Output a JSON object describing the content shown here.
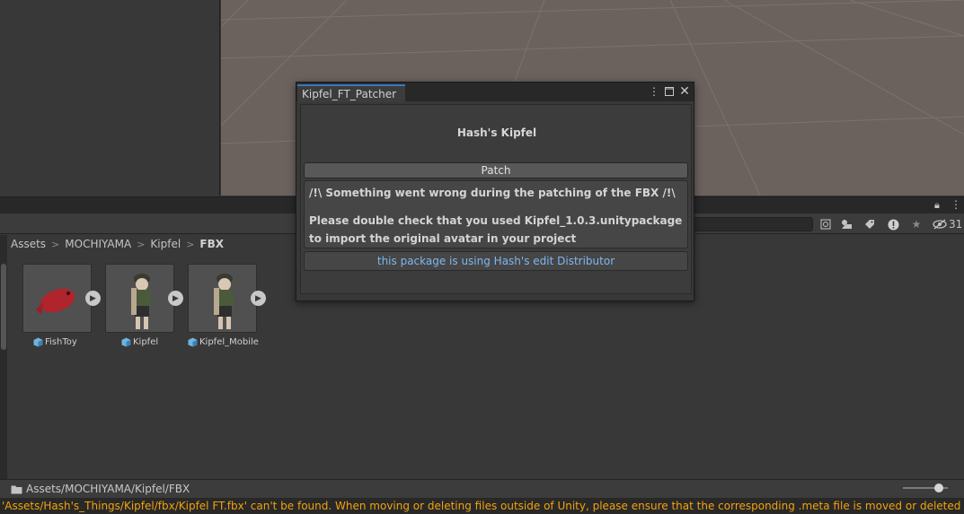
{
  "project": {
    "breadcrumb": [
      "Assets",
      "MOCHIYAMA",
      "Kipfel",
      "FBX"
    ],
    "breadcrumb_separator": ">",
    "hidden_count": "31",
    "assets": [
      {
        "name": "FishToy"
      },
      {
        "name": "Kipfel"
      },
      {
        "name": "Kipfel_Mobile"
      }
    ],
    "path": "Assets/MOCHIYAMA/Kipfel/FBX"
  },
  "window": {
    "tab_title": "Kipfel_FT_Patcher",
    "heading": "Hash's Kipfel",
    "patch_button": "Patch",
    "error_line": "/!\\ Something went wrong during the patching of the FBX /!\\",
    "hint_line1": "Please double check that you used Kipfel_1.0.3.unitypackage",
    "hint_line2": "to import the original avatar in your project",
    "link_text": "this package is using Hash's edit Distributor"
  },
  "status": {
    "message": "'Assets/Hash's_Things/Kipfel/fbx/Kipfel FT.fbx' can't be found. When moving or deleting files outside of Unity, please ensure that the corresponding .meta file is moved or deleted along with it."
  },
  "colors": {
    "status_warning": "#f2a20c",
    "link": "#7fb6f0",
    "tab_accent": "#3a79bb"
  },
  "icons": [
    "lock-icon",
    "kebab-menu-icon",
    "search-by-type-icon",
    "search-by-label-icon",
    "tag-icon",
    "warning-filter-icon",
    "favorite-icon",
    "hidden-packages-icon",
    "play-icon",
    "prefab-icon",
    "folder-icon",
    "maximize-icon",
    "close-icon"
  ]
}
